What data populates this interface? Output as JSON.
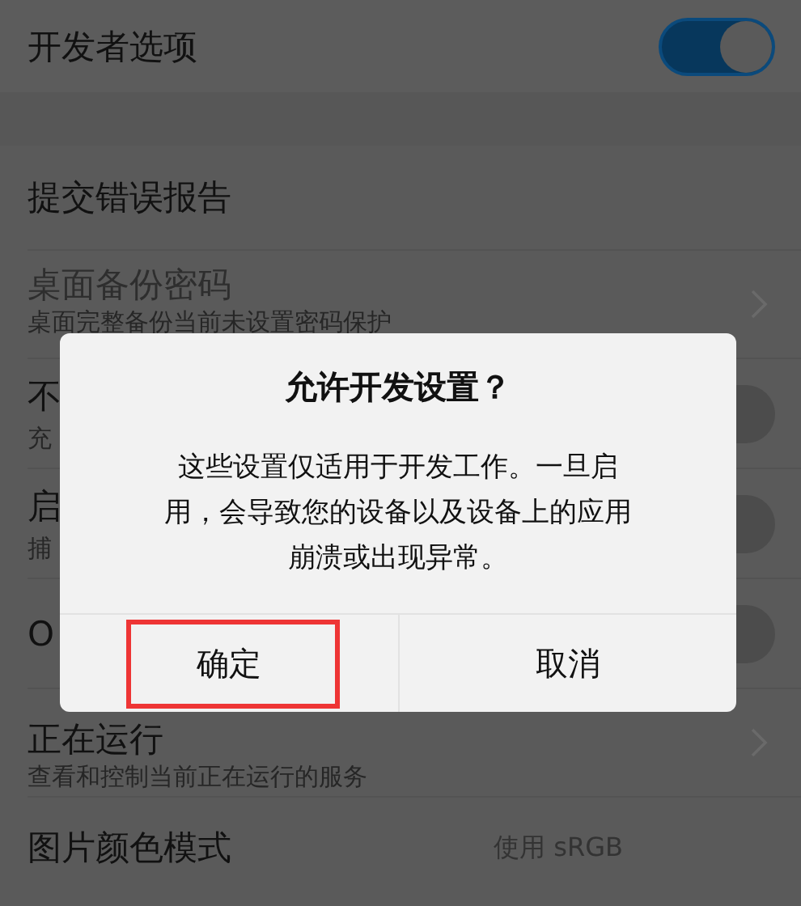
{
  "settings": [
    {
      "kind": "master",
      "title": "开发者选项",
      "on": true
    },
    {
      "kind": "gap"
    },
    {
      "kind": "plain",
      "title": "提交错误报告"
    },
    {
      "kind": "chevron",
      "title": "桌面备份密码",
      "subtitle": "桌面完整备份当前未设置密码保护",
      "disabled": true
    },
    {
      "kind": "switch",
      "title": "不",
      "subtitle": "充",
      "on": false
    },
    {
      "kind": "switch",
      "title": "启",
      "subtitle": "捕",
      "on": false
    },
    {
      "kind": "switch",
      "title": "O",
      "on": false
    },
    {
      "kind": "chevron",
      "title": "正在运行",
      "subtitle": "查看和控制当前正在运行的服务",
      "disabled": false
    },
    {
      "kind": "value",
      "title": "图片颜色模式",
      "value": "使用 sRGB"
    }
  ],
  "dialog": {
    "title": "允许开发设置？",
    "message": "这些设置仅适用于开发工作。一旦启用，会导致您的设备以及设备上的应用崩溃或出现异常。",
    "buttons": [
      {
        "label": "确定",
        "highlighted": true
      },
      {
        "label": "取消",
        "highlighted": false
      }
    ]
  }
}
